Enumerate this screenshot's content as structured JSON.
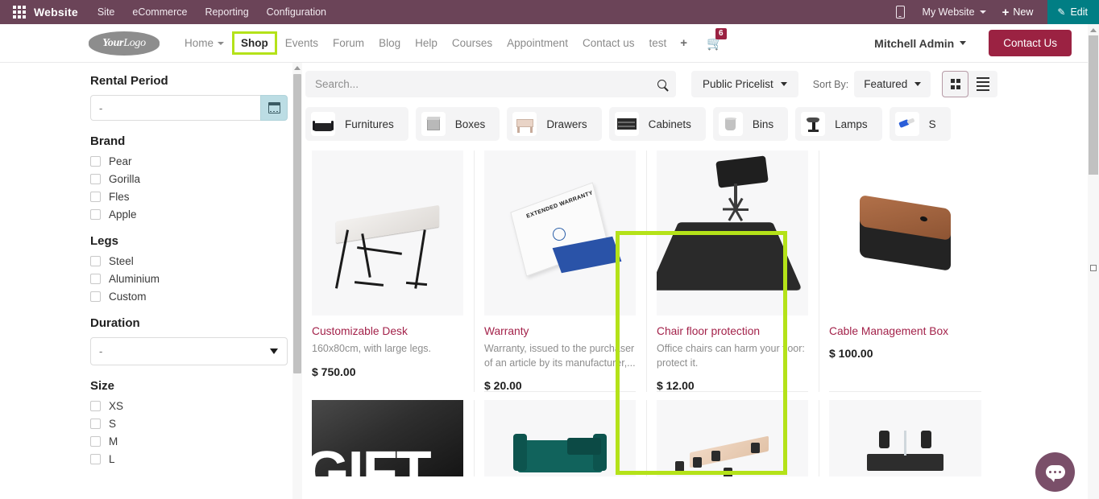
{
  "odoo_bar": {
    "apps_icon": "apps-grid-icon",
    "app_name": "Website",
    "menus": [
      "Site",
      "eCommerce",
      "Reporting",
      "Configuration"
    ],
    "mobile_preview_icon": "mobile-icon",
    "website_selector": "My Website",
    "new_label": "New",
    "new_icon": "plus-icon",
    "edit_label": "Edit",
    "edit_icon": "pencil-icon",
    "bg_color": "#6b4458",
    "edit_color": "#017e84"
  },
  "site_header": {
    "logo_your": "Your",
    "logo_logo": "Logo",
    "nav": [
      {
        "label": "Home",
        "has_caret": true,
        "active": false
      },
      {
        "label": "Shop",
        "has_caret": false,
        "active": true
      },
      {
        "label": "Events",
        "has_caret": false,
        "active": false
      },
      {
        "label": "Forum",
        "has_caret": false,
        "active": false
      },
      {
        "label": "Blog",
        "has_caret": false,
        "active": false
      },
      {
        "label": "Help",
        "has_caret": false,
        "active": false
      },
      {
        "label": "Courses",
        "has_caret": false,
        "active": false
      },
      {
        "label": "Appointment",
        "has_caret": false,
        "active": false
      },
      {
        "label": "Contact us",
        "has_caret": false,
        "active": false
      },
      {
        "label": "test",
        "has_caret": false,
        "active": false
      }
    ],
    "add_page_icon": "plus-icon",
    "cart_icon": "shopping-cart-icon",
    "cart_count": "6",
    "user_name": "Mitchell Admin",
    "contact_us_label": "Contact Us",
    "accent_color": "#9b2242",
    "highlight_color": "#b4e219"
  },
  "filters": {
    "rental_period": {
      "title": "Rental Period",
      "value": "-",
      "calendar_icon": "calendar-icon"
    },
    "brand": {
      "title": "Brand",
      "options": [
        "Pear",
        "Gorilla",
        "Fles",
        "Apple"
      ]
    },
    "legs": {
      "title": "Legs",
      "options": [
        "Steel",
        "Aluminium",
        "Custom"
      ]
    },
    "duration": {
      "title": "Duration",
      "value": "-",
      "caret_icon": "chevron-down-icon"
    },
    "size": {
      "title": "Size",
      "options": [
        "XS",
        "S",
        "M",
        "L"
      ]
    }
  },
  "toolbar": {
    "search_placeholder": "Search...",
    "search_value": "",
    "search_icon": "search-icon",
    "pricelist_label": "Public Pricelist",
    "sort_by_label": "Sort By:",
    "sort_value": "Featured",
    "grid_view_icon": "grid-view-icon",
    "list_view_icon": "list-view-icon"
  },
  "categories": [
    {
      "label": "Furnitures",
      "icon": "sofa-thumb"
    },
    {
      "label": "Boxes",
      "icon": "box-thumb"
    },
    {
      "label": "Drawers",
      "icon": "drawer-thumb"
    },
    {
      "label": "Cabinets",
      "icon": "cabinet-thumb"
    },
    {
      "label": "Bins",
      "icon": "bin-thumb"
    },
    {
      "label": "Lamps",
      "icon": "lamp-thumb"
    },
    {
      "label": "S",
      "icon": "usb-thumb"
    }
  ],
  "products": [
    {
      "name": "Customizable Desk",
      "description": "160x80cm, with large legs.",
      "price": "$ 750.00",
      "highlighted": true
    },
    {
      "name": "Warranty",
      "description": "Warranty, issued to the purchaser of an article by its manufacturer,...",
      "price": "$ 20.00",
      "highlighted": false
    },
    {
      "name": "Chair floor protection",
      "description": "Office chairs can harm your floor: protect it.",
      "price": "$ 12.00",
      "highlighted": false
    },
    {
      "name": "Cable Management Box",
      "description": "",
      "price": "$ 100.00",
      "highlighted": false
    }
  ],
  "products_row2": [
    {
      "art": "gift-card"
    },
    {
      "art": "sofa"
    },
    {
      "art": "meeting-table"
    },
    {
      "art": "monitor-stand"
    }
  ],
  "gift_card_text": "GIFT",
  "warranty_box_text": "EXTENDED WARRANTY",
  "chat": {
    "icon": "chat-bubble-icon",
    "color": "#7a4f69"
  },
  "scrollbars": {
    "left_up_icon": "scroll-up-arrow",
    "right_up_icon": "scroll-up-arrow"
  }
}
